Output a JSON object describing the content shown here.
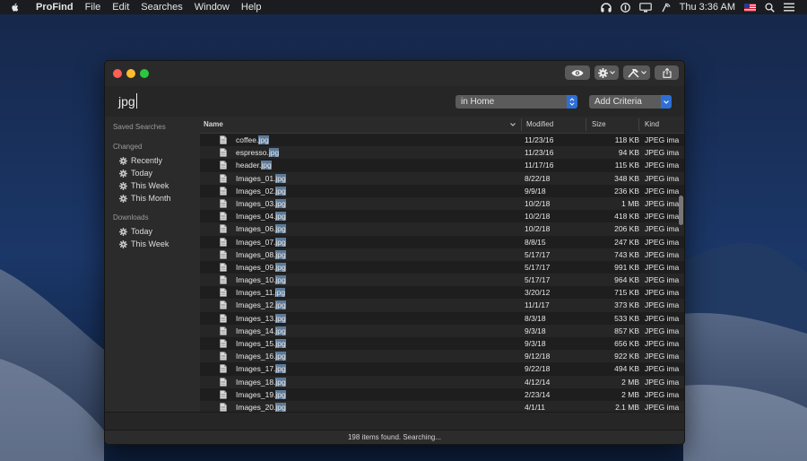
{
  "menubar": {
    "app_name": "ProFind",
    "menus": [
      "File",
      "Edit",
      "Searches",
      "Window",
      "Help"
    ],
    "clock": "Thu 3:36 AM"
  },
  "window": {
    "search_query": "jpg",
    "scope": "in Home",
    "criteria": "Add Criteria"
  },
  "sidebar": {
    "saved_searches": "Saved Searches",
    "changed": "Changed",
    "changed_items": [
      "Recently",
      "Today",
      "This Week",
      "This Month"
    ],
    "downloads": "Downloads",
    "downloads_items": [
      "Today",
      "This Week"
    ]
  },
  "table": {
    "columns": [
      "Name",
      "Modified",
      "Size",
      "Kind"
    ],
    "rows": [
      {
        "base": "coffee.",
        "ext": "jpg",
        "modified": "11/23/16",
        "size": "118 KB",
        "kind": "JPEG ima"
      },
      {
        "base": "espresso.",
        "ext": "jpg",
        "modified": "11/23/16",
        "size": "94 KB",
        "kind": "JPEG ima"
      },
      {
        "base": "header.",
        "ext": "jpg",
        "modified": "11/17/16",
        "size": "115 KB",
        "kind": "JPEG ima"
      },
      {
        "base": "Images_01.",
        "ext": "jpg",
        "modified": "8/22/18",
        "size": "348 KB",
        "kind": "JPEG ima"
      },
      {
        "base": "Images_02.",
        "ext": "jpg",
        "modified": "9/9/18",
        "size": "236 KB",
        "kind": "JPEG ima"
      },
      {
        "base": "Images_03.",
        "ext": "jpg",
        "modified": "10/2/18",
        "size": "1 MB",
        "kind": "JPEG ima"
      },
      {
        "base": "Images_04.",
        "ext": "jpg",
        "modified": "10/2/18",
        "size": "418 KB",
        "kind": "JPEG ima"
      },
      {
        "base": "Images_06.",
        "ext": "jpg",
        "modified": "10/2/18",
        "size": "206 KB",
        "kind": "JPEG ima"
      },
      {
        "base": "Images_07.",
        "ext": "jpg",
        "modified": "8/8/15",
        "size": "247 KB",
        "kind": "JPEG ima"
      },
      {
        "base": "Images_08.",
        "ext": "jpg",
        "modified": "5/17/17",
        "size": "743 KB",
        "kind": "JPEG ima"
      },
      {
        "base": "Images_09.",
        "ext": "jpg",
        "modified": "5/17/17",
        "size": "991 KB",
        "kind": "JPEG ima"
      },
      {
        "base": "Images_10.",
        "ext": "jpg",
        "modified": "5/17/17",
        "size": "964 KB",
        "kind": "JPEG ima"
      },
      {
        "base": "Images_11.",
        "ext": "jpg",
        "modified": "3/20/12",
        "size": "715 KB",
        "kind": "JPEG ima"
      },
      {
        "base": "Images_12.",
        "ext": "jpg",
        "modified": "11/1/17",
        "size": "373 KB",
        "kind": "JPEG ima"
      },
      {
        "base": "Images_13.",
        "ext": "jpg",
        "modified": "8/3/18",
        "size": "533 KB",
        "kind": "JPEG ima"
      },
      {
        "base": "Images_14.",
        "ext": "jpg",
        "modified": "9/3/18",
        "size": "857 KB",
        "kind": "JPEG ima"
      },
      {
        "base": "Images_15.",
        "ext": "jpg",
        "modified": "9/3/18",
        "size": "656 KB",
        "kind": "JPEG ima"
      },
      {
        "base": "Images_16.",
        "ext": "jpg",
        "modified": "9/12/18",
        "size": "922 KB",
        "kind": "JPEG ima"
      },
      {
        "base": "Images_17.",
        "ext": "jpg",
        "modified": "9/22/18",
        "size": "494 KB",
        "kind": "JPEG ima"
      },
      {
        "base": "Images_18.",
        "ext": "jpg",
        "modified": "4/12/14",
        "size": "2 MB",
        "kind": "JPEG ima"
      },
      {
        "base": "Images_19.",
        "ext": "jpg",
        "modified": "2/23/14",
        "size": "2 MB",
        "kind": "JPEG ima"
      },
      {
        "base": "Images_20.",
        "ext": "jpg",
        "modified": "4/1/11",
        "size": "2.1 MB",
        "kind": "JPEG ima"
      }
    ]
  },
  "status": "198 items found. Searching...",
  "icons": {
    "apple": "apple-icon",
    "preview": "eye-icon",
    "action": "gear-icon",
    "tools": "tools-icon",
    "share": "share-icon",
    "file": "document-icon",
    "sidebar": "gear-icon"
  },
  "colors": {
    "accent": "#2d6fd6",
    "highlight": "#5c7a99",
    "close": "#fe5f57",
    "minimize": "#febc2e",
    "zoom": "#28c840"
  }
}
